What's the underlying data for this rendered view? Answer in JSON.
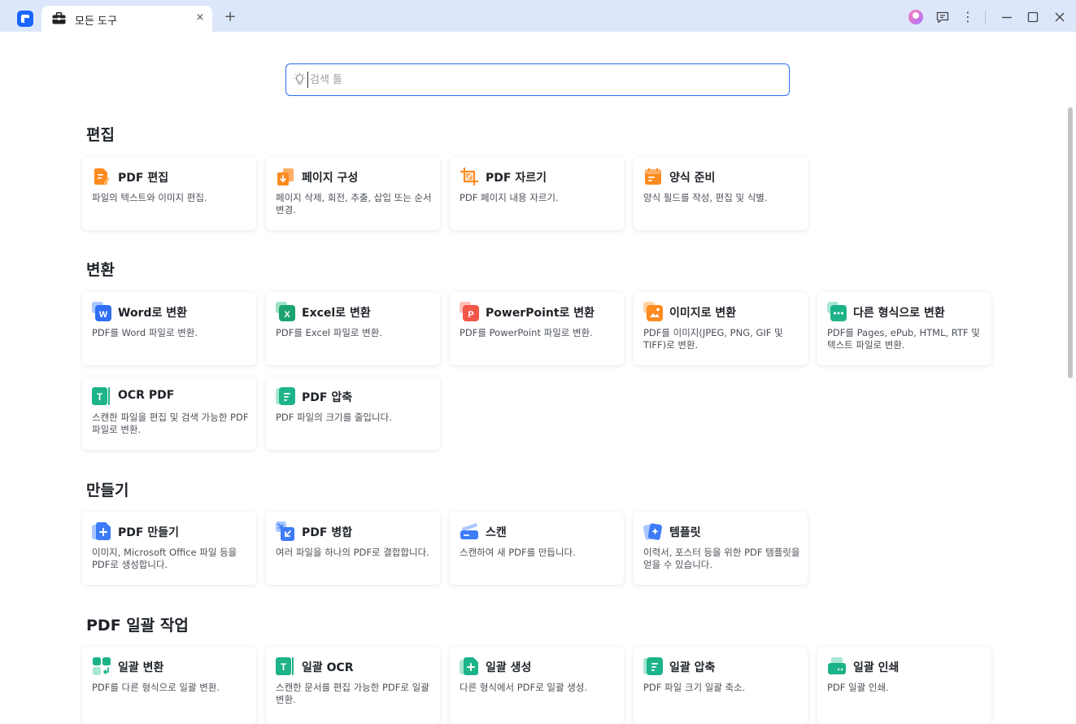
{
  "tab": {
    "title": "모든 도구",
    "close": "×"
  },
  "new_tab": "+",
  "window_controls": {
    "menu": "⋮",
    "minimize": "—",
    "close": "✕"
  },
  "search": {
    "placeholder": "검색 툴"
  },
  "sections": {
    "edit": {
      "title": "편집",
      "cards": [
        {
          "title": "PDF 편집",
          "desc": "파일의 텍스트와 이미지 편집."
        },
        {
          "title": "페이지 구성",
          "desc": "페이지 삭제, 회전, 추출, 삽입 또는 순서 변경."
        },
        {
          "title": "PDF 자르기",
          "desc": "PDF 페이지 내용 자르기."
        },
        {
          "title": "양식 준비",
          "desc": "양식 필드를 작성, 편집 및 식별."
        }
      ]
    },
    "convert": {
      "title": "변환",
      "cards": [
        {
          "title": "Word로 변환",
          "desc": "PDF를 Word 파일로 변환."
        },
        {
          "title": "Excel로 변환",
          "desc": "PDF를 Excel 파일로 변환."
        },
        {
          "title": "PowerPoint로 변환",
          "desc": "PDF를 PowerPoint 파일로 변환."
        },
        {
          "title": "이미지로 변환",
          "desc": "PDF를 이미지(JPEG, PNG, GIF 및 TIFF)로 변환."
        },
        {
          "title": "다른 형식으로 변환",
          "desc": "PDF를 Pages, ePub, HTML, RTF 및 텍스트 파일로 변환."
        },
        {
          "title": "OCR PDF",
          "desc": "스캔한 파일을 편집 및 검색 가능한 PDF 파일로 변환."
        },
        {
          "title": "PDF 압축",
          "desc": "PDF 파일의 크기를 줄입니다."
        }
      ]
    },
    "create": {
      "title": "만들기",
      "cards": [
        {
          "title": "PDF 만들기",
          "desc": "이미지, Microsoft Office 파일 등을 PDF로 생성합니다."
        },
        {
          "title": "PDF 병합",
          "desc": "여러 파일을 하나의 PDF로 결합합니다."
        },
        {
          "title": "스캔",
          "desc": "스캔하여 새 PDF를 만듭니다."
        },
        {
          "title": "템플릿",
          "desc": "이력서, 포스터 등을 위한 PDF 템플릿을 얻을 수 있습니다."
        }
      ]
    },
    "batch": {
      "title": "PDF 일괄 작업",
      "cards": [
        {
          "title": "일괄 변환",
          "desc": "PDF를 다른 형식으로 일괄 변환."
        },
        {
          "title": "일괄 OCR",
          "desc": "스캔한 문서를 편집 가능한 PDF로 일괄 변환."
        },
        {
          "title": "일괄 생성",
          "desc": "다른 형식에서 PDF로 일괄 생성."
        },
        {
          "title": "일괄 압축",
          "desc": "PDF 파일 크기 일괄 축소."
        },
        {
          "title": "일괄 인쇄",
          "desc": "PDF 일괄 인쇄."
        }
      ]
    }
  },
  "colors": {
    "accent": "#1a66ff",
    "titlebar": "#dde7fb",
    "orange": "#ff8a1f",
    "word": "#2f6ef5",
    "excel": "#1aa36f",
    "powerpoint": "#f2574a",
    "teal": "#1db389",
    "blue": "#3d7bf7"
  }
}
